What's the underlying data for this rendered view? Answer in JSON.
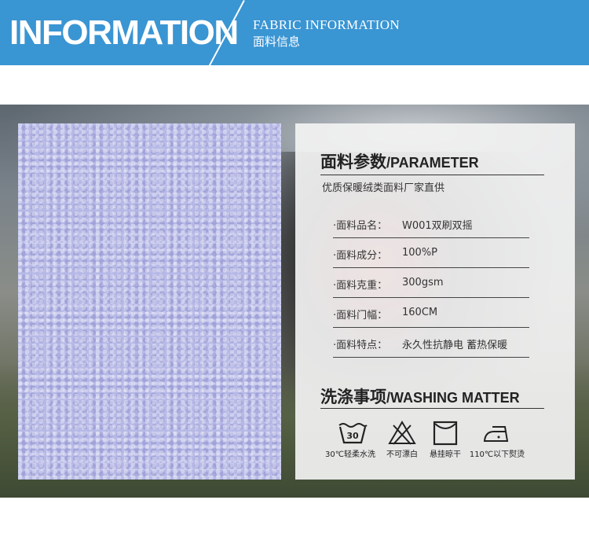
{
  "header": {
    "title": "INFORMATION",
    "subtitle_en": "FABRIC INFORMATION",
    "subtitle_cn": "面料信息",
    "bg_color": "#3a95d3"
  },
  "swatch": {
    "color": "#b6b8e6"
  },
  "parameter": {
    "title_cn": "面料参数",
    "title_en": "/PARAMETER",
    "intro": "优质保暖绒类面料厂家直供",
    "rows": [
      {
        "label": "·面料品名：",
        "value": "W001双刷双摇"
      },
      {
        "label": "·面料成分：",
        "value": "100%P"
      },
      {
        "label": "·面料克重：",
        "value": "300gsm"
      },
      {
        "label": "·面料门幅：",
        "value": "160CM"
      },
      {
        "label": "·面料特点：",
        "value": "永久性抗静电 蓄热保暖"
      }
    ]
  },
  "washing": {
    "title_cn": "洗涤事项",
    "title_en": "/WASHING MATTER",
    "icons": [
      {
        "icon": "wash-tub-icon",
        "number": "30",
        "label": "30℃轻柔水洗"
      },
      {
        "icon": "no-bleach-icon",
        "label": "不可漂白"
      },
      {
        "icon": "hang-dry-icon",
        "label": "悬挂晾干"
      },
      {
        "icon": "iron-icon",
        "label": "110℃以下熨烫"
      }
    ]
  }
}
